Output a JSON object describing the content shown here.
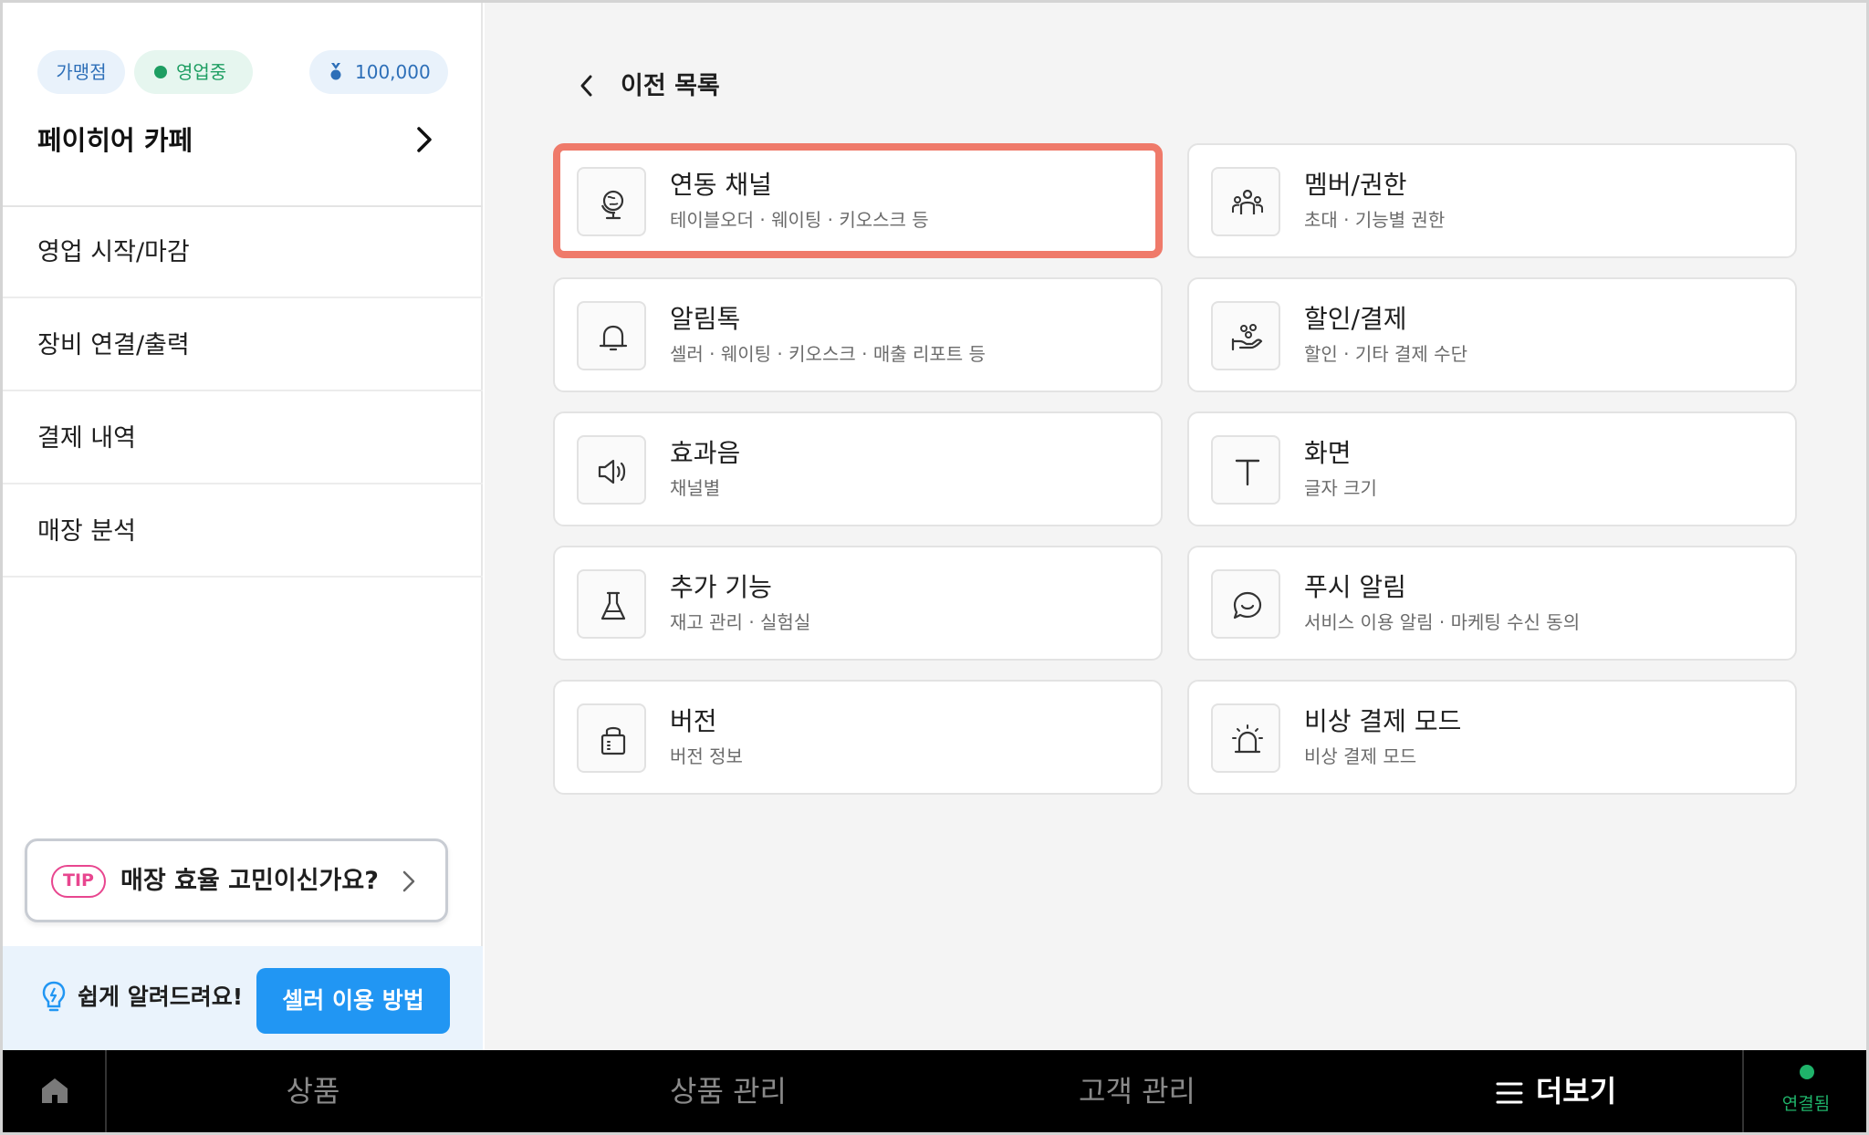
{
  "sidebar": {
    "chips": {
      "franchise": "가맹점",
      "status": "영업중",
      "points": "100,000"
    },
    "store_name": "페이히어 카페",
    "menu": [
      {
        "label": "영업 시작/마감"
      },
      {
        "label": "장비 연결/출력"
      },
      {
        "label": "결제 내역"
      },
      {
        "label": "매장 분석"
      }
    ],
    "tip": {
      "badge": "TIP",
      "text": "매장 효율 고민이신가요?"
    },
    "help": {
      "text": "쉽게 알려드려요!",
      "button": "셀러 이용 방법"
    }
  },
  "main": {
    "back_label": "이전 목록",
    "cards": [
      {
        "title": "연동 채널",
        "sub": "테이블오더 · 웨이팅 · 키오스크 등",
        "icon": "globe-icon",
        "selected": true
      },
      {
        "title": "멤버/권한",
        "sub": "초대 · 기능별 권한",
        "icon": "users-icon"
      },
      {
        "title": "알림톡",
        "sub": "셀러 · 웨이팅 · 키오스크 · 매출 리포트 등",
        "icon": "bell-icon"
      },
      {
        "title": "할인/결제",
        "sub": "할인 · 기타 결제 수단",
        "icon": "hand-coins-icon"
      },
      {
        "title": "효과음",
        "sub": "채널별",
        "icon": "speaker-icon"
      },
      {
        "title": "화면",
        "sub": "글자 크기",
        "icon": "text-size-icon"
      },
      {
        "title": "추가 기능",
        "sub": "재고 관리 · 실험실",
        "icon": "flask-icon"
      },
      {
        "title": "푸시 알림",
        "sub": "서비스 이용 알림 · 마케팅 수신 동의",
        "icon": "chat-smile-icon"
      },
      {
        "title": "버전",
        "sub": "버전 정보",
        "icon": "bag-icon"
      },
      {
        "title": "비상 결제 모드",
        "sub": "비상 결제 모드",
        "icon": "siren-icon"
      }
    ]
  },
  "bottom_nav": {
    "tabs": [
      {
        "label": "상품"
      },
      {
        "label": "상품 관리"
      },
      {
        "label": "고객 관리"
      },
      {
        "label": "더보기"
      }
    ],
    "connection": "연결됨"
  },
  "colors": {
    "accent": "#2196f3",
    "selected_border": "#ef7a6a",
    "tip_pink": "#e8468f",
    "connected_green": "#1fb36a"
  }
}
